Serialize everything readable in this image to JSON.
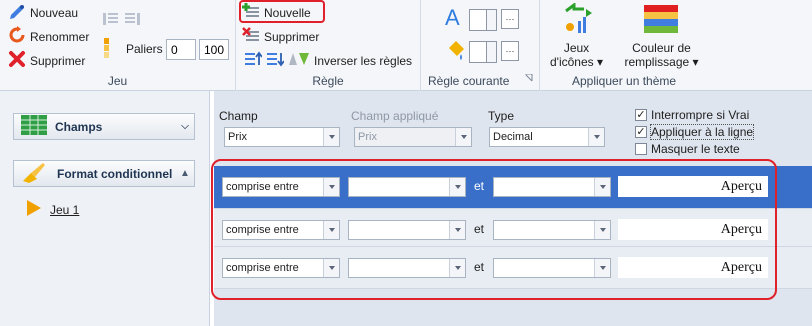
{
  "ribbon": {
    "jeu": {
      "new_label": "Nouveau",
      "rename_label": "Renommer",
      "delete_label": "Supprimer",
      "paliers_label": "Paliers",
      "paliers_min": "0",
      "paliers_max": "100",
      "group_label": "Jeu"
    },
    "regle": {
      "new_label": "Nouvelle",
      "delete_label": "Supprimer",
      "invert_label": "Inverser les règles",
      "group_label": "Règle"
    },
    "regle_courante": {
      "group_label": "Règle courante",
      "text_color_icon": "A",
      "more_label": "···"
    },
    "theme": {
      "icons_label_1": "Jeux",
      "icons_label_2": "d'icônes ▾",
      "fill_label_1": "Couleur de",
      "fill_label_2": "remplissage ▾",
      "group_label": "Appliquer un thème"
    }
  },
  "left": {
    "champs_label": "Champs",
    "format_label": "Format conditionnel",
    "set_label": "Jeu 1"
  },
  "header": {
    "champ_label": "Champ",
    "champ_value": "Prix",
    "champ_applique_label": "Champ appliqué",
    "champ_applique_value": "Prix",
    "type_label": "Type",
    "type_value": "Decimal",
    "chk_interrompre": "Interrompre si Vrai",
    "chk_appliquer": "Appliquer à la ligne",
    "chk_masquer": "Masquer le texte"
  },
  "rows": [
    {
      "operator": "comprise entre",
      "value1": "",
      "and": "et",
      "value2": "",
      "preview": "Aperçu"
    },
    {
      "operator": "comprise entre",
      "value1": "",
      "and": "et",
      "value2": "",
      "preview": "Aperçu"
    },
    {
      "operator": "comprise entre",
      "value1": "",
      "and": "et",
      "value2": "",
      "preview": "Aperçu"
    }
  ],
  "colors": {
    "selected_row": "#3a6fc9",
    "highlight": "#e0202a",
    "accent": "#2f6fd1"
  }
}
